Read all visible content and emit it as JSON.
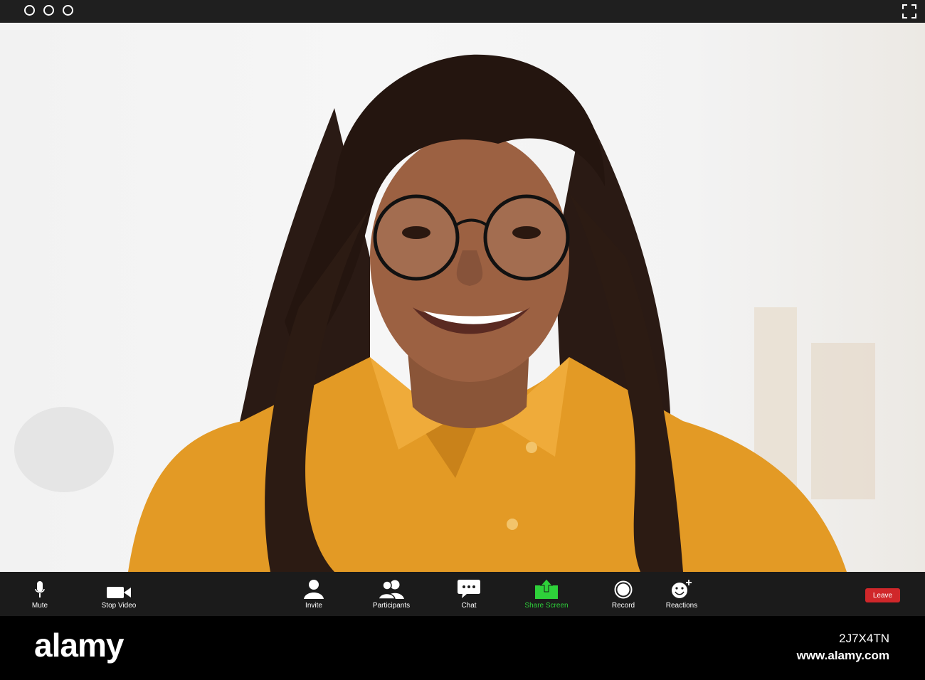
{
  "window": {
    "controls": [
      "circle-button",
      "circle-button",
      "circle-button"
    ],
    "fullscreen_icon": "fullscreen-icon"
  },
  "video": {
    "subject": "participant-video-feed"
  },
  "toolbar": {
    "mute_label": "Mute",
    "stop_video_label": "Stop Video",
    "invite_label": "Invite",
    "participants_label": "Participants",
    "chat_label": "Chat",
    "share_screen_label": "Share Screen",
    "record_label": "Record",
    "reactions_label": "Reactions",
    "leave_label": "Leave"
  },
  "footer": {
    "brand": "alamy",
    "image_id": "2J7X4TN",
    "url": "www.alamy.com"
  },
  "colors": {
    "toolbar_bg": "#1b1b1b",
    "share_green": "#2ed13a",
    "leave_red": "#d0272a"
  }
}
